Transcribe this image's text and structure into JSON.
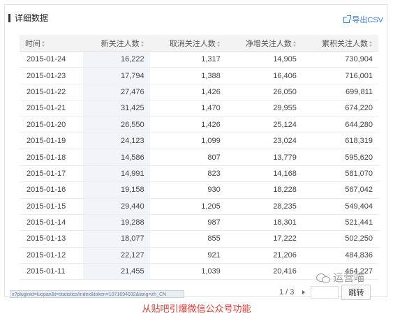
{
  "header": {
    "title": "详细数据",
    "export_label": "导出CSV"
  },
  "table": {
    "columns": [
      "时间",
      "新关注人数",
      "取消关注人数",
      "净增关注人数",
      "累积关注人数"
    ],
    "rows": [
      [
        "2015-01-24",
        "16,222",
        "1,317",
        "14,905",
        "730,904"
      ],
      [
        "2015-01-23",
        "17,794",
        "1,388",
        "16,406",
        "716,001"
      ],
      [
        "2015-01-22",
        "27,476",
        "1,426",
        "26,050",
        "699,811"
      ],
      [
        "2015-01-21",
        "31,425",
        "1,470",
        "29,955",
        "674,220"
      ],
      [
        "2015-01-20",
        "26,550",
        "1,426",
        "25,124",
        "644,280"
      ],
      [
        "2015-01-19",
        "24,123",
        "1,099",
        "23,024",
        "618,319"
      ],
      [
        "2015-01-18",
        "14,586",
        "807",
        "13,779",
        "595,620"
      ],
      [
        "2015-01-17",
        "14,991",
        "823",
        "14,168",
        "581,070"
      ],
      [
        "2015-01-16",
        "19,158",
        "930",
        "18,228",
        "567,042"
      ],
      [
        "2015-01-15",
        "29,440",
        "1,205",
        "28,235",
        "549,404"
      ],
      [
        "2015-01-14",
        "19,288",
        "987",
        "18,301",
        "521,441"
      ],
      [
        "2015-01-13",
        "18,077",
        "855",
        "17,222",
        "502,250"
      ],
      [
        "2015-01-12",
        "22,127",
        "921",
        "21,206",
        "484,836"
      ],
      [
        "2015-01-11",
        "21,455",
        "1,039",
        "20,416",
        "464,227"
      ]
    ]
  },
  "pager": {
    "info": "1 / 3",
    "jump_label": "跳转",
    "jump_value": ""
  },
  "watermark": "运营喵",
  "status_url": "x?pluginid=luopan&t=statistics/index&token=1071694932&lang=zh_CN",
  "caption": "从贴吧引爆微信公众号功能",
  "colors": {
    "accent": "#3a7bd5",
    "caption": "#e53935",
    "header_bg": "#f3f3f3",
    "highlight_col": "#f2f4f7"
  }
}
